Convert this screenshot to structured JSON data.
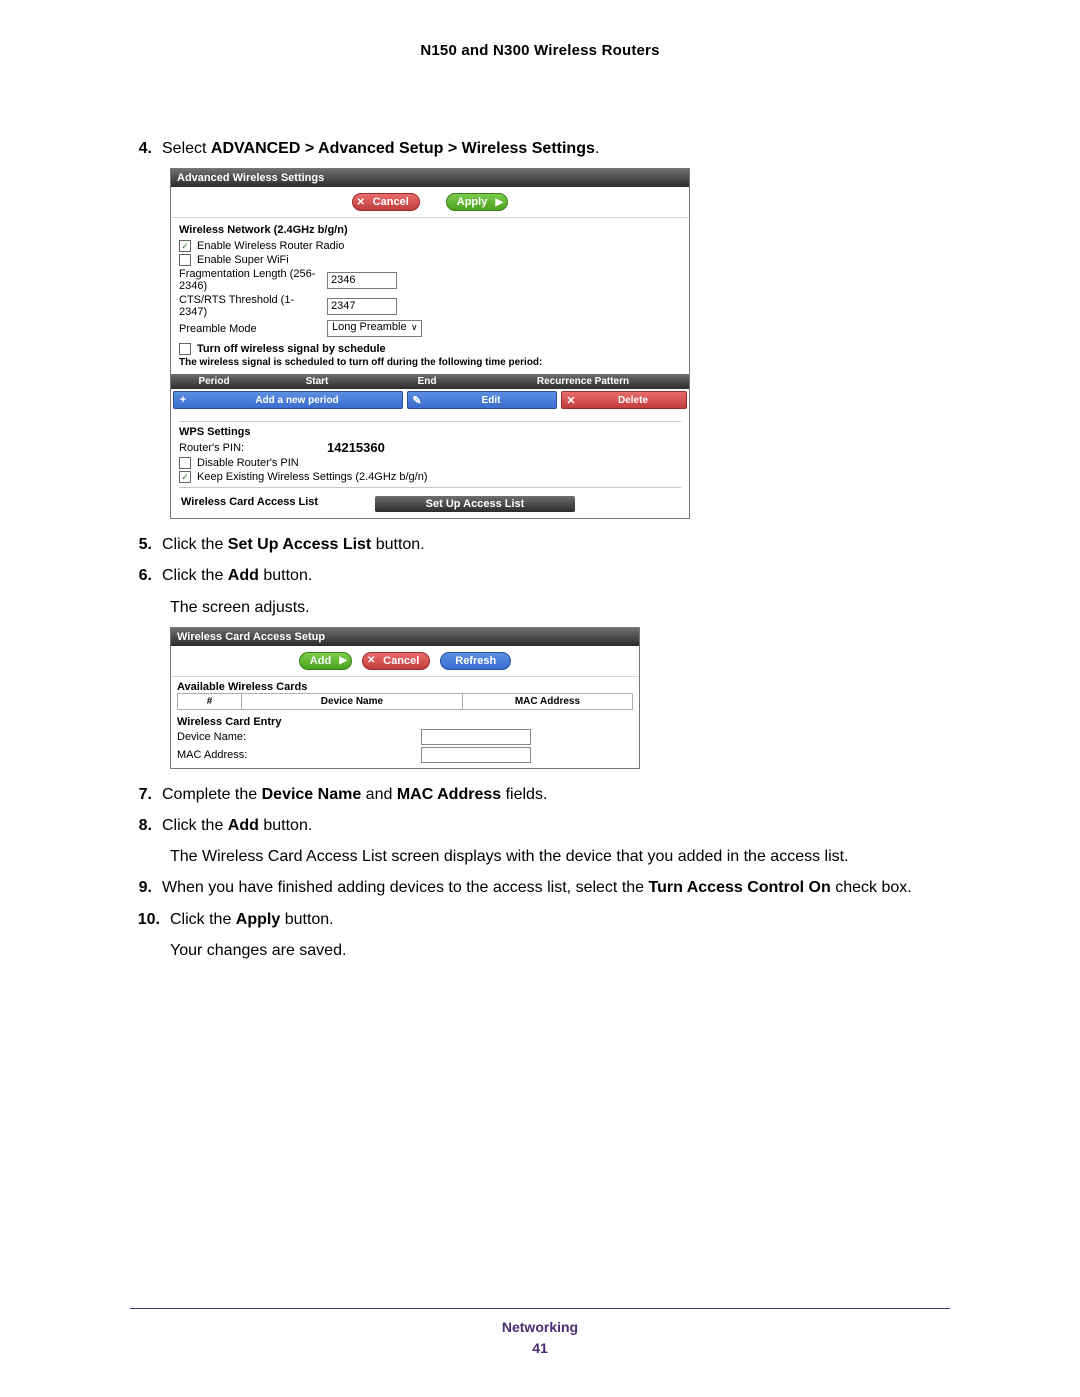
{
  "header_title": "N150 and N300 Wireless Routers",
  "steps": {
    "s4": {
      "num": "4.",
      "pre": "Select ",
      "bold": "ADVANCED > Advanced Setup > Wireless Settings",
      "post": "."
    },
    "s5": {
      "num": "5.",
      "pre": "Click the ",
      "bold": "Set Up Access List",
      "post": " button."
    },
    "s6": {
      "num": "6.",
      "pre": "Click the ",
      "bold": "Add",
      "post": " button."
    },
    "s6b": "The screen adjusts.",
    "s7": {
      "num": "7.",
      "pre": "Complete the ",
      "bold1": "Device Name",
      "mid": " and ",
      "bold2": "MAC Address",
      "post": " fields."
    },
    "s8": {
      "num": "8.",
      "pre": "Click the ",
      "bold": "Add",
      "post": " button."
    },
    "s8b": "The Wireless Card Access List screen displays with the device that you added in the access list.",
    "s9": {
      "num": "9.",
      "pre": "When you have finished adding devices to the access list, select the ",
      "bold": "Turn Access Control On",
      "post": " check box."
    },
    "s10": {
      "num": "10.",
      "pre": "Click the ",
      "bold": "Apply",
      "post": " button."
    },
    "s10b": "Your changes are saved."
  },
  "ss1": {
    "title": "Advanced Wireless Settings",
    "btn_cancel": "Cancel",
    "btn_apply": "Apply",
    "sect1": "Wireless Network (2.4GHz b/g/n)",
    "chk_router_radio": "Enable Wireless Router Radio",
    "chk_super_wifi": "Enable Super WiFi",
    "frag_label": "Fragmentation Length (256-2346)",
    "frag_val": "2346",
    "cts_label": "CTS/RTS Threshold (1-2347)",
    "cts_val": "2347",
    "preamble_label": "Preamble Mode",
    "preamble_val": "Long Preamble",
    "turnoff_label": "Turn off wireless signal by schedule",
    "turnoff_desc": "The wireless signal is scheduled to turn off during the following time period:",
    "col_period": "Period",
    "col_start": "Start",
    "col_end": "End",
    "col_rec": "Recurrence Pattern",
    "btn_add_period": "Add a new period",
    "btn_edit": "Edit",
    "btn_delete": "Delete",
    "wps_sect": "WPS Settings",
    "router_pin_label": "Router's PIN:",
    "router_pin": "14215360",
    "disable_pin": "Disable Router's PIN",
    "keep_existing": "Keep Existing Wireless Settings (2.4GHz b/g/n)",
    "access_list_label": "Wireless Card Access List",
    "btn_setup_access": "Set Up Access List"
  },
  "ss2": {
    "title": "Wireless Card Access Setup",
    "btn_add": "Add",
    "btn_cancel": "Cancel",
    "btn_refresh": "Refresh",
    "avail": "Available Wireless Cards",
    "th_num": "#",
    "th_dev": "Device Name",
    "th_mac": "MAC Address",
    "entry_sect": "Wireless Card Entry",
    "dev_name_label": "Device Name:",
    "mac_label": "MAC Address:"
  },
  "footer": {
    "section": "Networking",
    "page": "41"
  }
}
